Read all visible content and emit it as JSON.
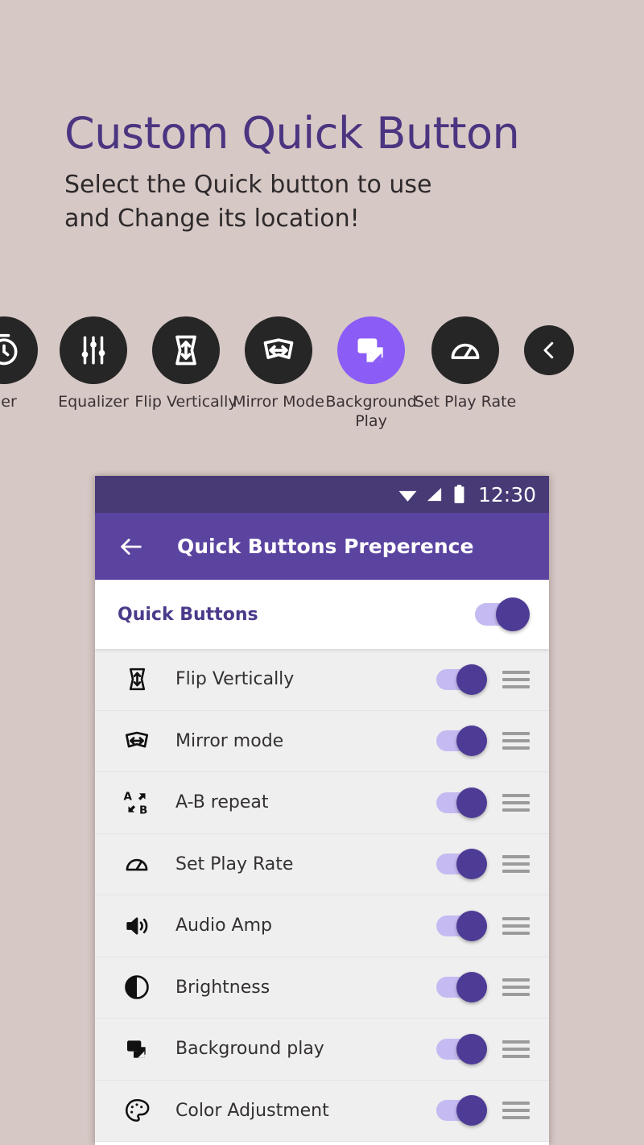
{
  "promo": {
    "title": "Custom Quick Button",
    "subtitle_line1": "Select the Quick button to use",
    "subtitle_line2": "and Change its location!"
  },
  "carousel": {
    "items": [
      {
        "label": "ner",
        "icon": "timer-icon",
        "active": false,
        "partial": true
      },
      {
        "label": "Equalizer",
        "icon": "equalizer-icon",
        "active": false
      },
      {
        "label": "Flip Vertically",
        "icon": "flip-vertical-icon",
        "active": false
      },
      {
        "label": "Mirror Mode",
        "icon": "mirror-mode-icon",
        "active": false
      },
      {
        "label": "Background Play",
        "icon": "background-play-icon",
        "active": true
      },
      {
        "label": "Set Play Rate",
        "icon": "play-rate-icon",
        "active": false
      },
      {
        "label": "",
        "icon": "chevron-left-icon",
        "active": false
      }
    ]
  },
  "phone": {
    "statusbar": {
      "time": "12:30",
      "icons": [
        "wifi-icon",
        "signal-icon",
        "battery-icon"
      ]
    },
    "appbar": {
      "back_label": "back-arrow",
      "title": "Quick Buttons Preperence"
    },
    "master": {
      "label": "Quick Buttons",
      "toggle_on": true
    },
    "rows": [
      {
        "label": "Flip Vertically",
        "icon": "flip-vertical-icon",
        "toggle_on": true
      },
      {
        "label": "Mirror mode",
        "icon": "mirror-mode-icon",
        "toggle_on": true
      },
      {
        "label": "A-B repeat",
        "icon": "ab-repeat-icon",
        "toggle_on": true
      },
      {
        "label": "Set Play Rate",
        "icon": "play-rate-icon",
        "toggle_on": true
      },
      {
        "label": "Audio Amp",
        "icon": "volume-icon",
        "toggle_on": true
      },
      {
        "label": "Brightness",
        "icon": "brightness-icon",
        "toggle_on": true
      },
      {
        "label": "Background play",
        "icon": "background-play-icon",
        "toggle_on": true
      },
      {
        "label": "Color Adjustment",
        "icon": "palette-icon",
        "toggle_on": true
      }
    ]
  },
  "colors": {
    "background": "#d6c8c5",
    "title_purple": "#4b3480",
    "accent_purple": "#8b5cf6",
    "appbar_purple": "#5b44a0",
    "statusbar_purple": "#483a75",
    "toggle_thumb": "#4e3b96",
    "toggle_track": "#c5bbf2",
    "icon_circle_dark": "#262626",
    "row_background": "#efefef"
  }
}
